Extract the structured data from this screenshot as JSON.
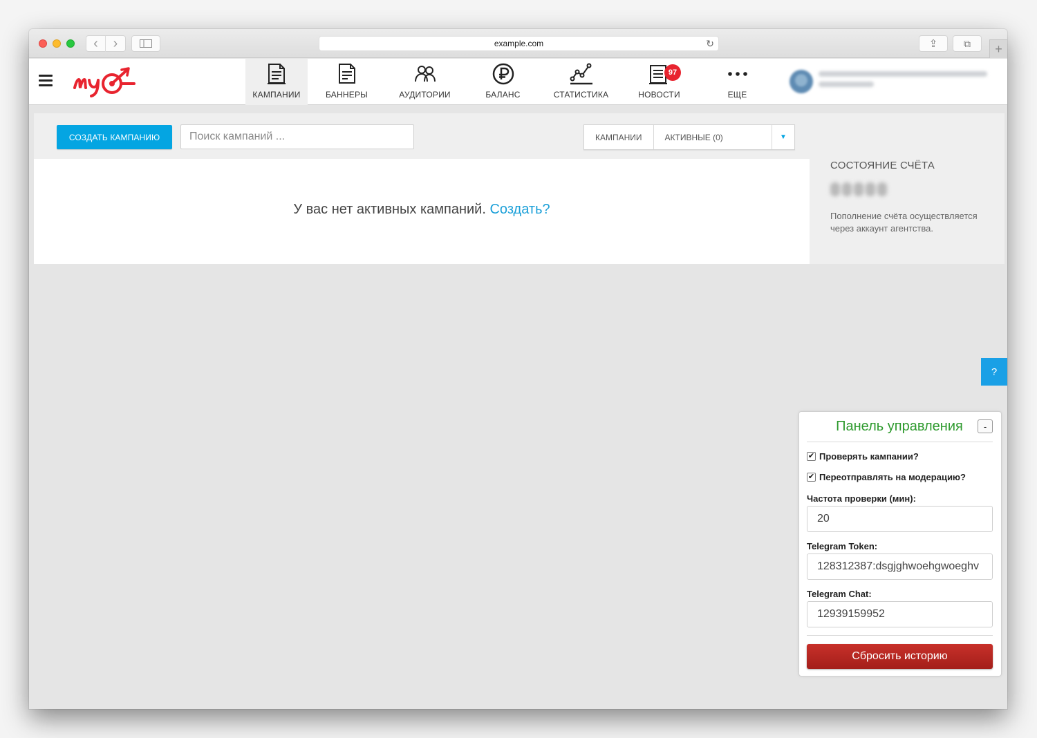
{
  "browser": {
    "url": "example.com",
    "back_glyph": "‹",
    "forward_glyph": "›",
    "reload_glyph": "↻",
    "newtab_glyph": "+",
    "share_glyph": "⇪",
    "tabs_glyph": "⧉"
  },
  "nav": {
    "items": [
      {
        "label": "КАМПАНИИ",
        "icon": "campaigns-icon",
        "active": true
      },
      {
        "label": "БАННЕРЫ",
        "icon": "banners-icon"
      },
      {
        "label": "АУДИТОРИИ",
        "icon": "audiences-icon"
      },
      {
        "label": "БАЛАНС",
        "icon": "balance-icon"
      },
      {
        "label": "СТАТИСТИКА",
        "icon": "statistics-icon"
      },
      {
        "label": "НОВОСТИ",
        "icon": "news-icon",
        "badge": "97"
      },
      {
        "label": "ЕЩЕ",
        "icon": "more-icon"
      }
    ]
  },
  "toolbar": {
    "create_label": "СОЗДАТЬ КАМПАНИЮ",
    "search_placeholder": "Поиск кампаний ...",
    "filter_type": "КАМПАНИИ",
    "filter_status": "АКТИВНЫЕ (0)"
  },
  "empty": {
    "message": "У вас нет активных кампаний.",
    "link": "Создать?"
  },
  "account": {
    "title": "СОСТОЯНИЕ СЧЁТА",
    "note": "Пополнение счёта осуществляется через аккаунт агентства."
  },
  "help": {
    "label": "?"
  },
  "panel": {
    "title": "Панель управления",
    "collapse_label": "-",
    "check_campaigns": {
      "label": "Проверять кампании?",
      "checked": true
    },
    "resend_moderation": {
      "label": "Переотправлять на модерацию?",
      "checked": true
    },
    "frequency_label": "Частота проверки (мин):",
    "frequency_value": "20",
    "token_label": "Telegram Token:",
    "token_value": "128312387:dsgjghwoehgwoeghv",
    "chat_label": "Telegram Chat:",
    "chat_value": "12939159952",
    "reset_label": "Сбросить историю"
  },
  "colors": {
    "accent_blue": "#04a5e2",
    "brand_red": "#e8242f",
    "panel_green": "#2e9a2e",
    "reset_red": "#b52822"
  }
}
